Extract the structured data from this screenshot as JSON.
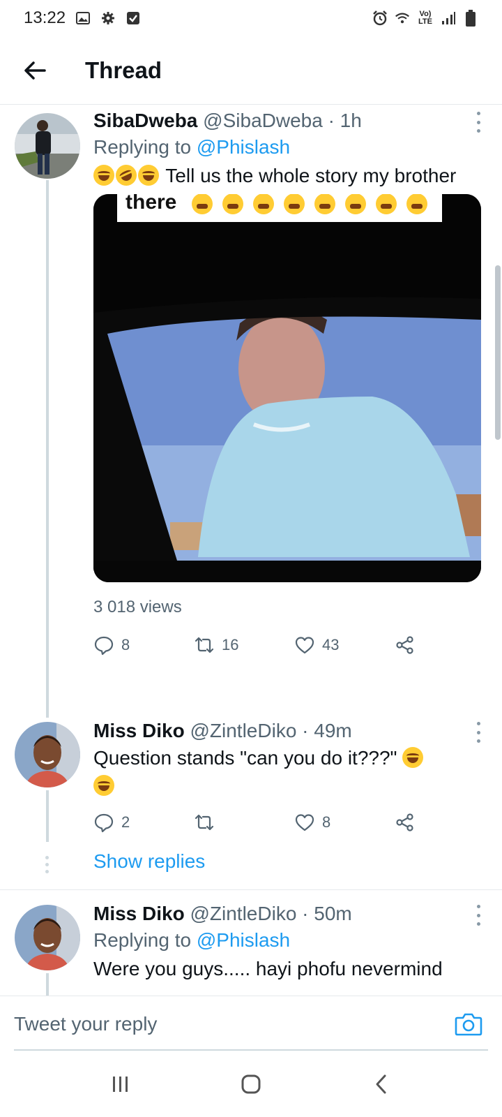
{
  "status_bar": {
    "time": "13:22",
    "left_icons": [
      "image-icon",
      "gear-icon",
      "checkbox-icon"
    ],
    "right_icons": [
      "alarm-icon",
      "wifi-icon",
      "volte-icon",
      "signal-icon",
      "battery-icon"
    ],
    "volte_label": "Vo) LTE"
  },
  "header": {
    "title": "Thread"
  },
  "tweets": [
    {
      "name": "SibaDweba",
      "handle": "@SibaDweba",
      "time": "· 1h",
      "replying_label": "Replying to",
      "replying_to": "@Phislash",
      "text": "Tell us the whole story my brother",
      "media_caption": "there",
      "views": "3 018 views",
      "replies": "8",
      "retweets": "16",
      "likes": "43"
    },
    {
      "name": "Miss Diko",
      "handle": "@ZintleDiko",
      "time": "· 49m",
      "text": "Question stands \"can you do it???\"",
      "replies": "2",
      "retweets": "",
      "likes": "8",
      "show_replies": "Show replies"
    },
    {
      "name": "Miss Diko",
      "handle": "@ZintleDiko",
      "time": "· 50m",
      "replying_label": "Replying to",
      "replying_to": "@Phislash",
      "text": "Were you guys..... hayi phofu nevermind"
    }
  ],
  "reply_bar": {
    "placeholder": "Tweet your reply"
  },
  "colors": {
    "accent": "#1d9bf0",
    "text": "#0f1419",
    "secondary": "#536471"
  }
}
